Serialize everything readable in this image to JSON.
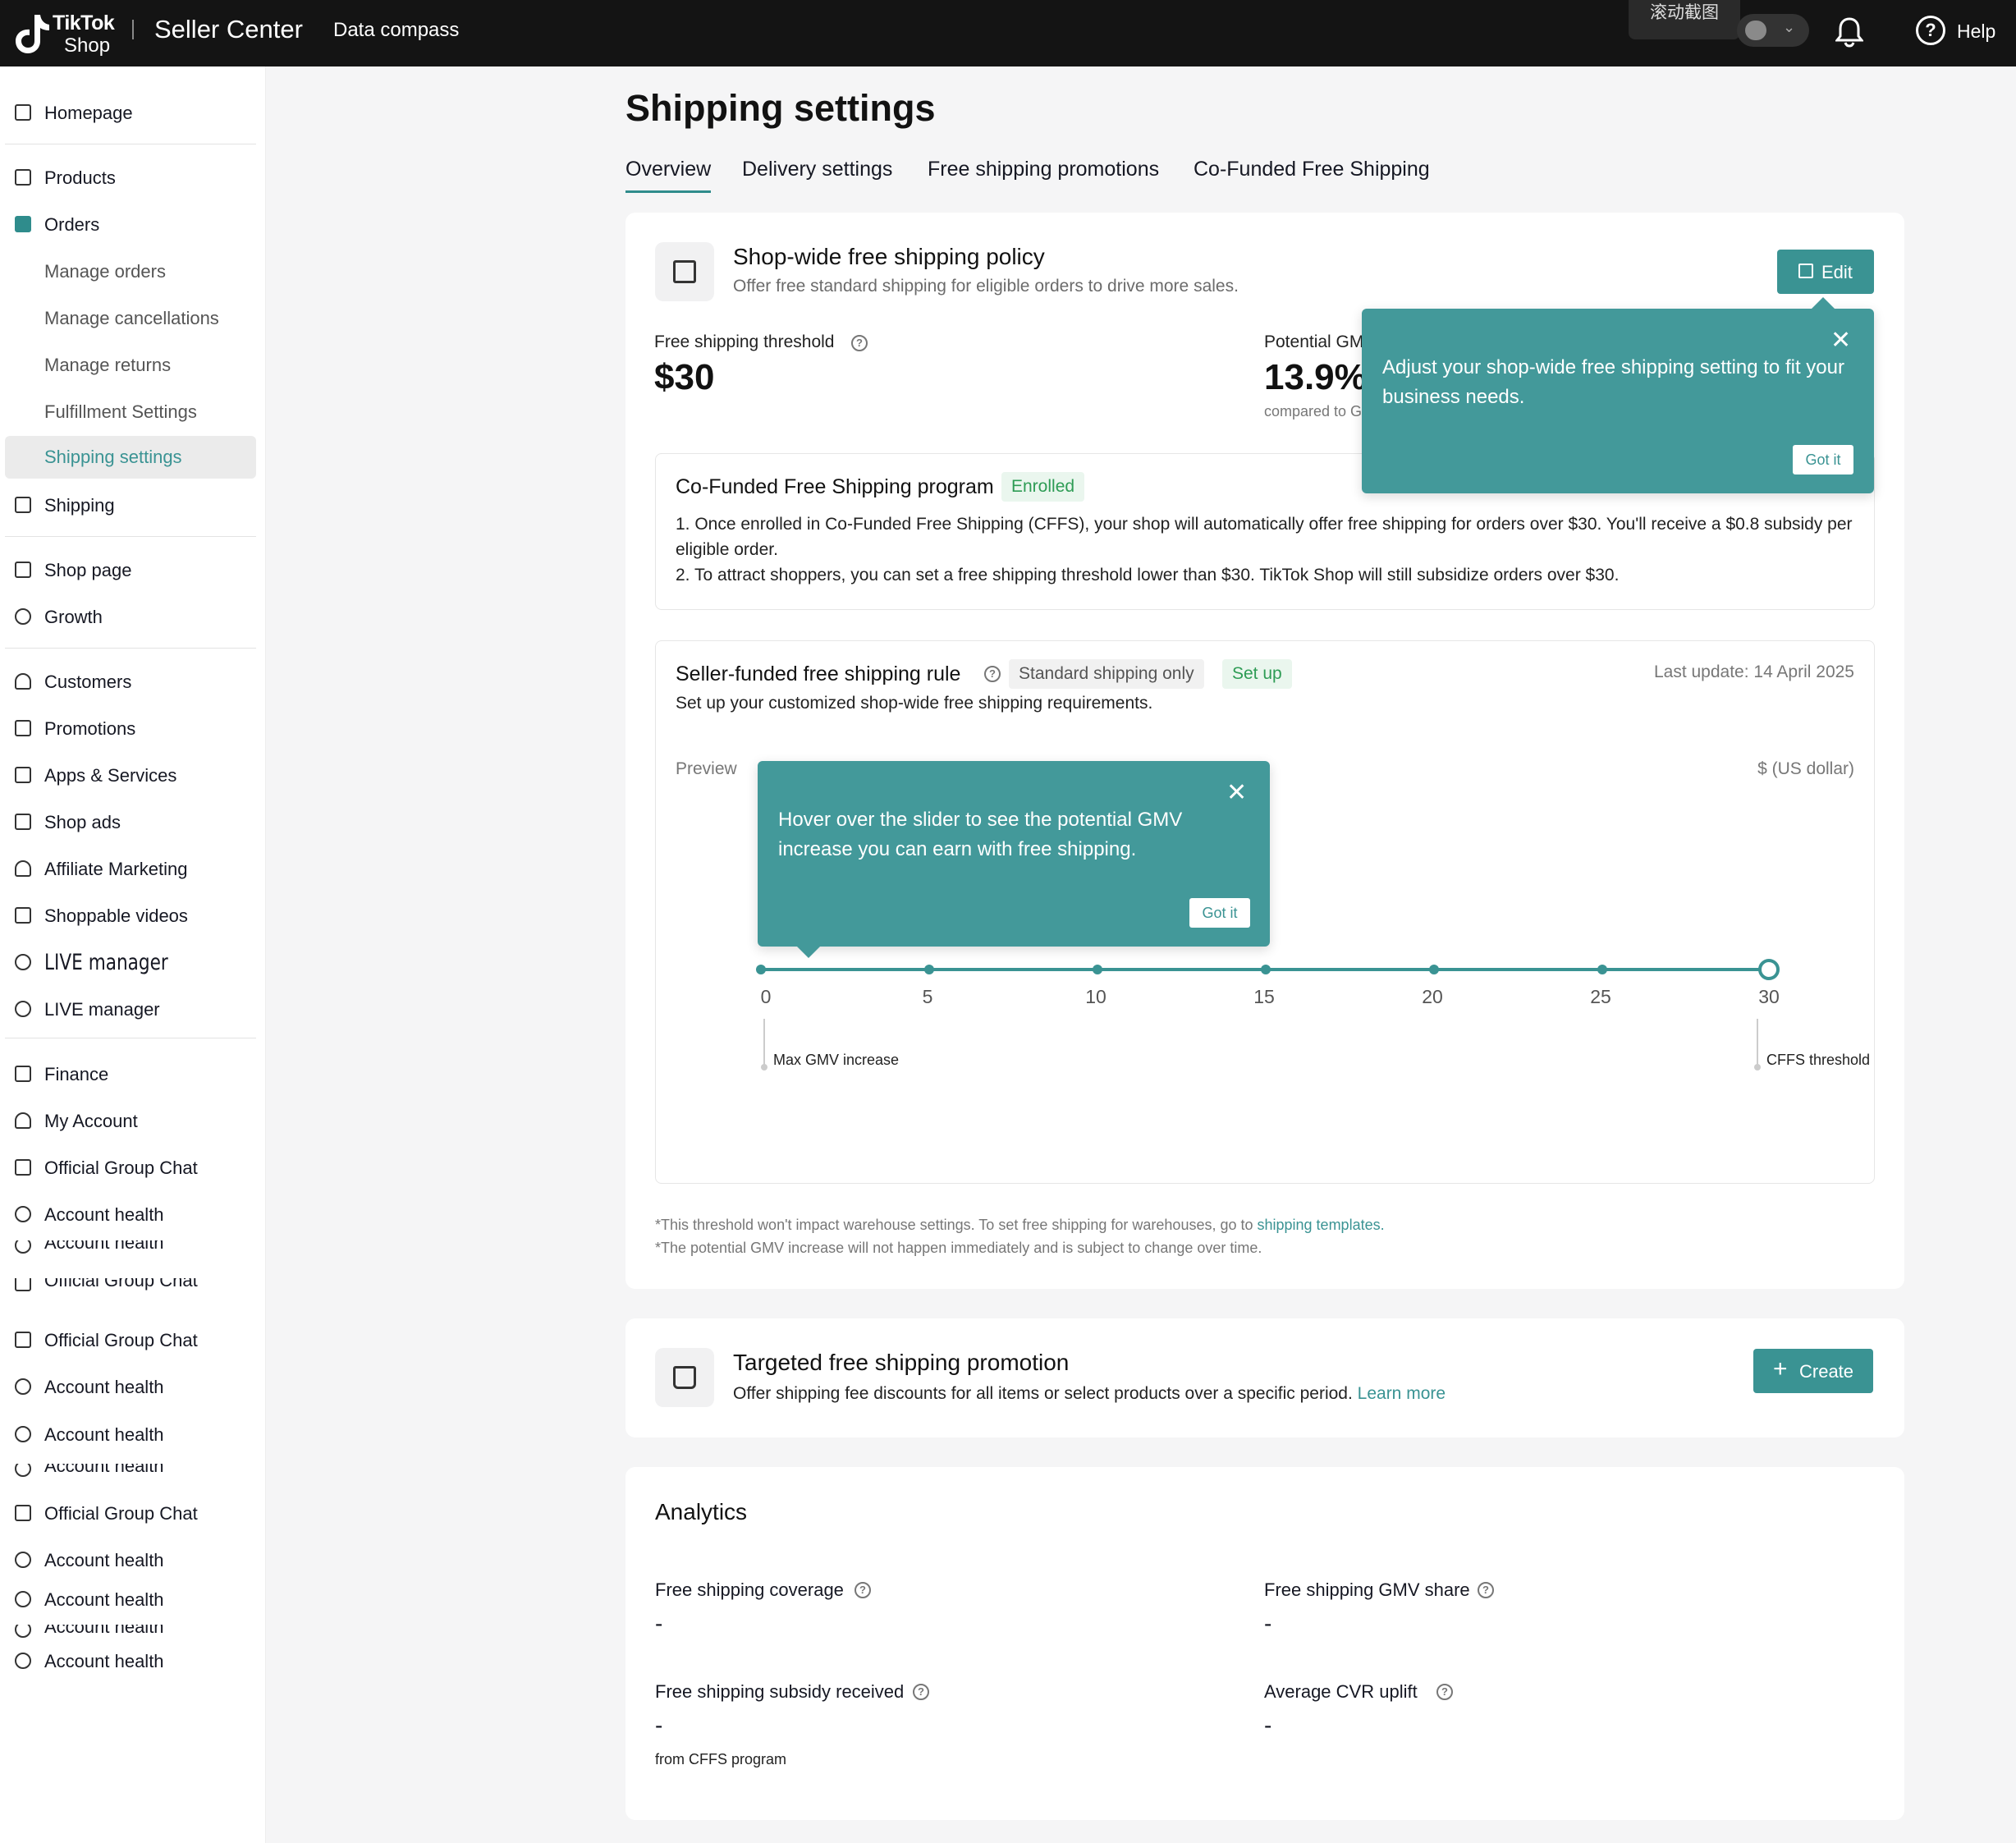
{
  "topbar": {
    "logo_line1": "TikTok",
    "logo_line2": "Shop",
    "title": "Seller Center",
    "nav": "Data compass",
    "screenshot_badge": "滚动截图",
    "help": "Help"
  },
  "sidebar": {
    "items": [
      {
        "label": "Homepage"
      },
      {
        "label": "Products"
      },
      {
        "label": "Orders"
      },
      {
        "label": "Manage orders"
      },
      {
        "label": "Manage cancellations"
      },
      {
        "label": "Manage returns"
      },
      {
        "label": "Fulfillment Settings"
      },
      {
        "label": "Shipping settings"
      },
      {
        "label": "Shipping"
      },
      {
        "label": "Shop page"
      },
      {
        "label": "Growth"
      },
      {
        "label": "Customers"
      },
      {
        "label": "Promotions"
      },
      {
        "label": "Apps & Services"
      },
      {
        "label": "Shop ads"
      },
      {
        "label": "Affiliate Marketing"
      },
      {
        "label": "Shoppable videos"
      },
      {
        "label": "LIVE manager"
      },
      {
        "label": "LIVE manager"
      },
      {
        "label": "Finance"
      },
      {
        "label": "My Account"
      },
      {
        "label": "Official Group Chat"
      },
      {
        "label": "Account health"
      },
      {
        "label": "Account health"
      },
      {
        "label": "Official Group Chat"
      },
      {
        "label": "Official Group Chat"
      },
      {
        "label": "Account health"
      },
      {
        "label": "Account health"
      },
      {
        "label": "Account health"
      },
      {
        "label": "Official Group Chat"
      },
      {
        "label": "Account health"
      },
      {
        "label": "Account health"
      },
      {
        "label": "Account health"
      },
      {
        "label": "Account health"
      }
    ]
  },
  "page": {
    "title": "Shipping settings",
    "tabs": [
      "Overview",
      "Delivery settings",
      "Free shipping promotions",
      "Co-Funded Free Shipping"
    ]
  },
  "policy": {
    "title": "Shop-wide free shipping policy",
    "subtitle": "Offer free standard shipping for eligible orders to drive more sales.",
    "edit_label": "Edit",
    "threshold_label": "Free shipping threshold",
    "threshold_value": "$30",
    "potential_label": "Potential GM",
    "potential_value": "13.9%",
    "compared_label": "compared to G"
  },
  "cffs": {
    "title": "Co-Funded Free Shipping program",
    "badge": "Enrolled",
    "line1": "1. Once enrolled in Co-Funded Free Shipping (CFFS), your shop will automatically offer free shipping for orders over $30. You'll receive a $0.8 subsidy per eligible order.",
    "line2": "2. To attract shoppers, you can set a free shipping threshold lower than $30. TikTok Shop will still subsidize orders over $30."
  },
  "rule": {
    "title": "Seller-funded free shipping rule",
    "badge_standard": "Standard shipping only",
    "badge_setup": "Set up",
    "last_update": "Last update: 14 April 2025",
    "subtitle": "Set up your customized shop-wide free shipping requirements.",
    "preview": "Preview",
    "currency": "$ (US dollar)",
    "ticks": [
      "0",
      "5",
      "10",
      "15",
      "20",
      "25",
      "30"
    ],
    "slider_value": 30,
    "marker_left": "Max GMV increase",
    "marker_right": "CFFS threshold"
  },
  "tooltip_top": {
    "text": "Adjust your shop-wide free shipping setting to fit your business needs.",
    "button": "Got it",
    "close": "✕"
  },
  "tooltip_slider": {
    "text": "Hover over the slider to see the potential GMV increase you can earn with free shipping.",
    "button": "Got it",
    "close": "✕"
  },
  "footnotes": {
    "line1_prefix": "*This threshold won't impact warehouse settings. To set free shipping for warehouses, go to ",
    "line1_link": "shipping templates.",
    "line2": "*The potential GMV increase will not happen immediately and is subject to change over time."
  },
  "targeted": {
    "title": "Targeted free shipping promotion",
    "subtitle": "Offer shipping fee discounts for all items or select products over a specific period.",
    "learn_more": "Learn more",
    "create": "Create"
  },
  "analytics": {
    "title": "Analytics",
    "coverage_label": "Free shipping coverage",
    "coverage_value": "-",
    "gmv_share_label": "Free shipping GMV share",
    "gmv_share_value": "-",
    "subsidy_label": "Free shipping subsidy received",
    "subsidy_value": "-",
    "subsidy_note": "from CFFS program",
    "cvr_label": "Average CVR uplift",
    "cvr_value": "-"
  },
  "colors": {
    "accent": "#3a9393",
    "tooltip_bg": "#43999a",
    "topbar_bg": "#141414",
    "enrolled_green": "#2e9c55"
  }
}
